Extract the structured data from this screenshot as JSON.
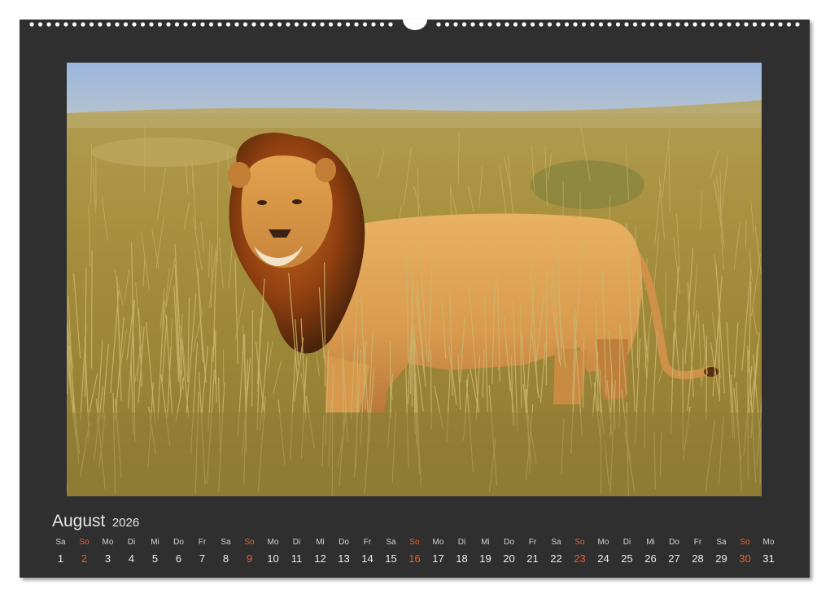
{
  "calendar": {
    "month": "August",
    "year": "2026",
    "colors": {
      "frame": "#2f2f30",
      "text": "#ececec",
      "sunday_accent": "#e4612f",
      "binding_holes": "#ffffff"
    },
    "photo": {
      "icon": "lion-photo"
    },
    "days": [
      {
        "weekday": "Sa",
        "day": "1",
        "sunday": false
      },
      {
        "weekday": "So",
        "day": "2",
        "sunday": true
      },
      {
        "weekday": "Mo",
        "day": "3",
        "sunday": false
      },
      {
        "weekday": "Di",
        "day": "4",
        "sunday": false
      },
      {
        "weekday": "Mi",
        "day": "5",
        "sunday": false
      },
      {
        "weekday": "Do",
        "day": "6",
        "sunday": false
      },
      {
        "weekday": "Fr",
        "day": "7",
        "sunday": false
      },
      {
        "weekday": "Sa",
        "day": "8",
        "sunday": false
      },
      {
        "weekday": "So",
        "day": "9",
        "sunday": true
      },
      {
        "weekday": "Mo",
        "day": "10",
        "sunday": false
      },
      {
        "weekday": "Di",
        "day": "11",
        "sunday": false
      },
      {
        "weekday": "Mi",
        "day": "12",
        "sunday": false
      },
      {
        "weekday": "Do",
        "day": "13",
        "sunday": false
      },
      {
        "weekday": "Fr",
        "day": "14",
        "sunday": false
      },
      {
        "weekday": "Sa",
        "day": "15",
        "sunday": false
      },
      {
        "weekday": "So",
        "day": "16",
        "sunday": true
      },
      {
        "weekday": "Mo",
        "day": "17",
        "sunday": false
      },
      {
        "weekday": "Di",
        "day": "18",
        "sunday": false
      },
      {
        "weekday": "Mi",
        "day": "19",
        "sunday": false
      },
      {
        "weekday": "Do",
        "day": "20",
        "sunday": false
      },
      {
        "weekday": "Fr",
        "day": "21",
        "sunday": false
      },
      {
        "weekday": "Sa",
        "day": "22",
        "sunday": false
      },
      {
        "weekday": "So",
        "day": "23",
        "sunday": true
      },
      {
        "weekday": "Mo",
        "day": "24",
        "sunday": false
      },
      {
        "weekday": "Di",
        "day": "25",
        "sunday": false
      },
      {
        "weekday": "Mi",
        "day": "26",
        "sunday": false
      },
      {
        "weekday": "Do",
        "day": "27",
        "sunday": false
      },
      {
        "weekday": "Fr",
        "day": "28",
        "sunday": false
      },
      {
        "weekday": "Sa",
        "day": "29",
        "sunday": false
      },
      {
        "weekday": "So",
        "day": "30",
        "sunday": true
      },
      {
        "weekday": "Mo",
        "day": "31",
        "sunday": false
      }
    ]
  }
}
